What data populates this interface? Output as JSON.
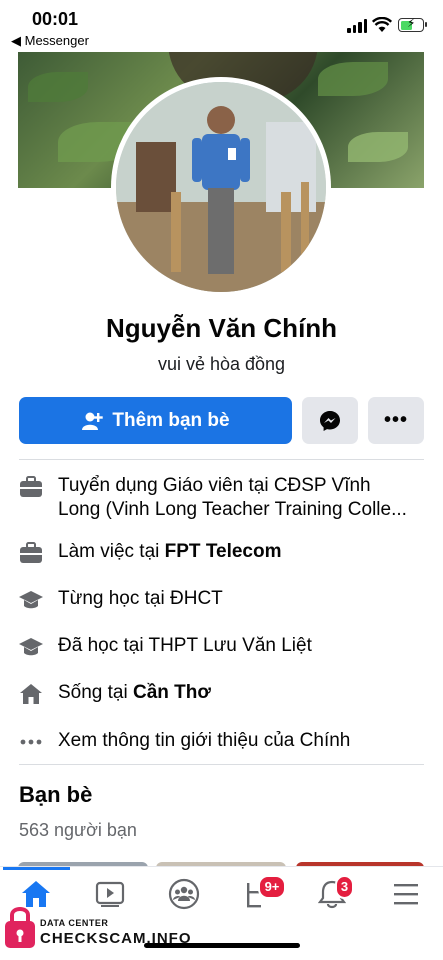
{
  "status_bar": {
    "time": "00:01",
    "back_app": "◀ Messenger",
    "battery_level": 0.55,
    "battery_color": "#4cd964"
  },
  "profile": {
    "name": "Nguyễn Văn Chính",
    "bio": "vui vẻ hòa đồng"
  },
  "actions": {
    "add_friend_label": "Thêm bạn bè",
    "add_friend_icon": "add-friend-icon",
    "messenger_icon": "messenger-icon",
    "more_label": "•••",
    "accent_color": "#1b74e4"
  },
  "details": [
    {
      "icon": "briefcase-icon",
      "text_line1": "Tuyển dụng Giáo viên tại CĐSP Vĩnh",
      "text_line2": "Long (Vinh Long Teacher Training Colle..."
    },
    {
      "icon": "briefcase-icon",
      "prefix": "Làm việc tại ",
      "bold": "FPT Telecom"
    },
    {
      "icon": "graduation-cap-icon",
      "prefix": "Từng học tại ĐHCT"
    },
    {
      "icon": "graduation-cap-icon",
      "prefix": "Đã học tại THPT Lưu Văn Liệt"
    },
    {
      "icon": "home-icon",
      "prefix": "Sống tại ",
      "bold": "Cần Thơ"
    },
    {
      "icon": "ellipsis-icon",
      "prefix": "Xem thông tin giới thiệu của Chính"
    }
  ],
  "friends": {
    "title": "Bạn bè",
    "count": "563 người bạn"
  },
  "tabbar": {
    "tabs": [
      "home-icon",
      "video-icon",
      "groups-icon",
      "marketplace-icon",
      "notifications-icon",
      "menu-icon"
    ],
    "marketplace_badge": "9+",
    "notifications_badge": "3",
    "badge_color": "#e41e3f"
  },
  "watermark": {
    "small": "DATA CENTER",
    "big": "CHECKSCAM.INFO"
  }
}
